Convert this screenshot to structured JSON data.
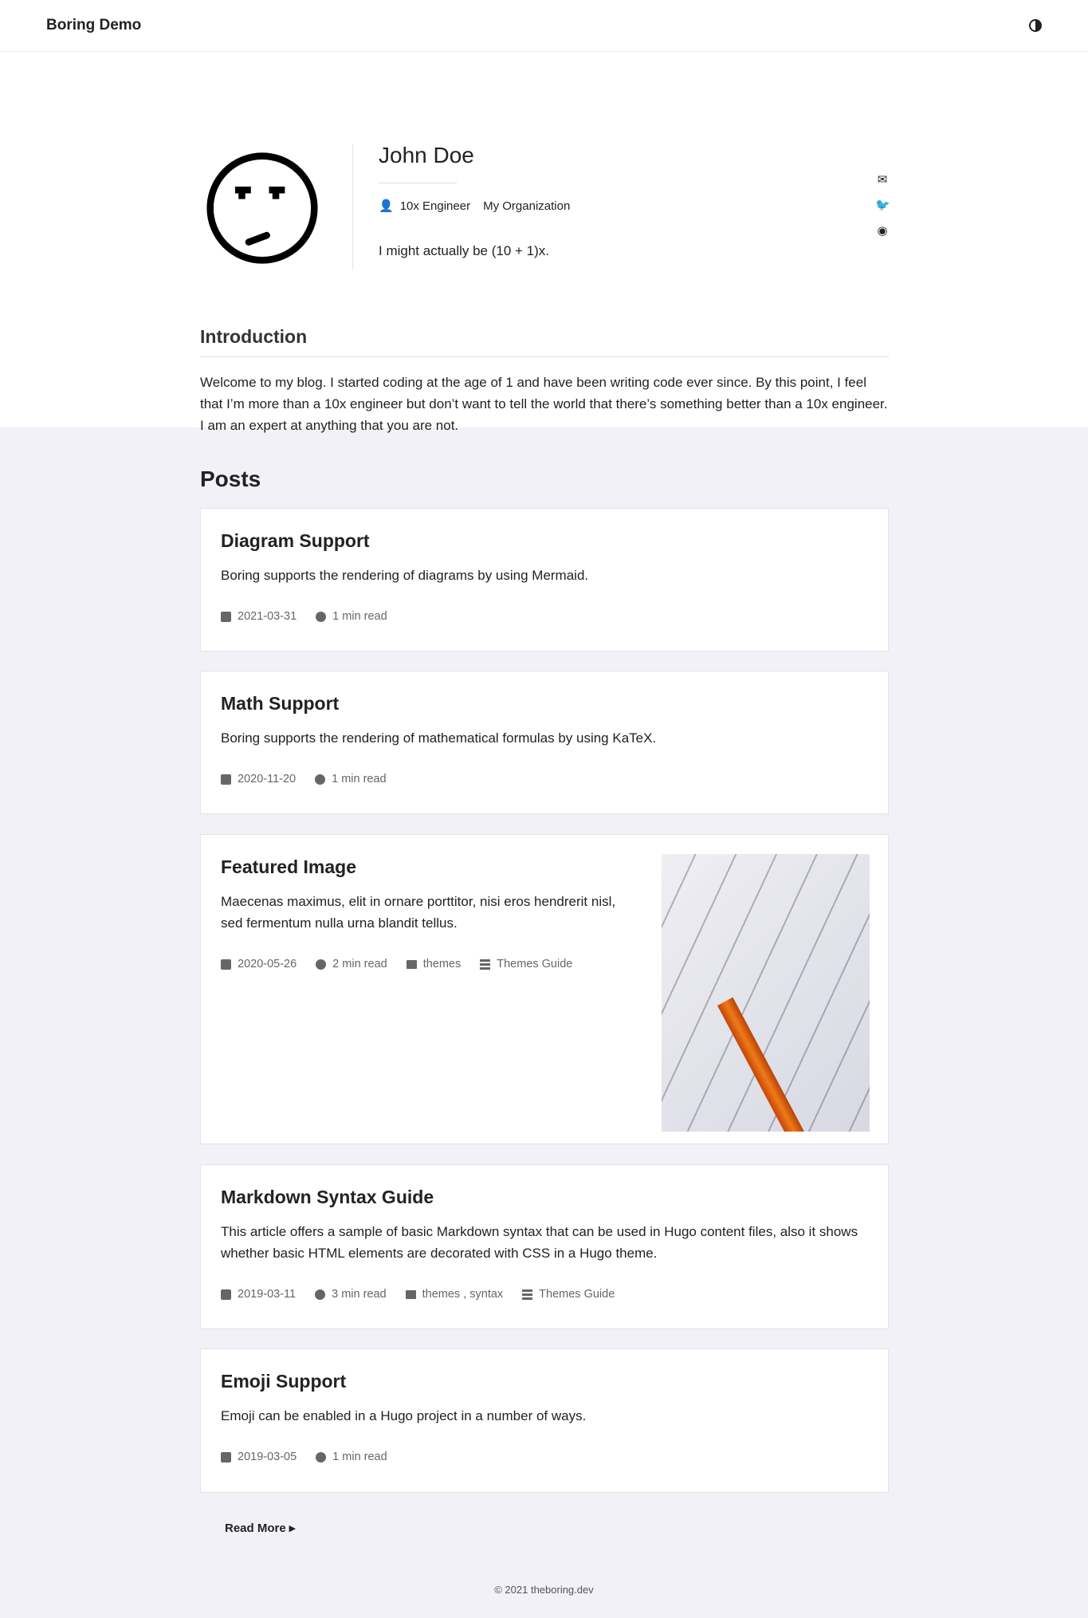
{
  "nav": {
    "brand": "Boring Demo",
    "theme_icon": "half-circle-icon"
  },
  "profile": {
    "name": "John Doe",
    "role": "10x Engineer",
    "organization": "My Organization",
    "bio": "I might actually be (10 + 1)x.",
    "social": [
      "envelope-icon",
      "twitter-icon",
      "github-icon"
    ]
  },
  "intro": {
    "title": "Introduction",
    "text": "Welcome to my blog. I started coding at the age of 1 and have been writing code ever since. By this point, I feel that I’m more than a 10x engineer but don’t want to tell the world that there’s something better than a 10x engineer. I am an expert at anything that you are not."
  },
  "posts": {
    "title": "Posts",
    "items": [
      {
        "title": "Diagram Support",
        "summary": "Boring supports the rendering of diagrams by using Mermaid.",
        "date": "2021-03-31",
        "read": "1 min read"
      },
      {
        "title": "Math Support",
        "summary": "Boring supports the rendering of mathematical formulas by using KaTeX.",
        "date": "2020-11-20",
        "read": "1 min read"
      },
      {
        "title": "Featured Image",
        "summary": "Maecenas maximus, elit in ornare porttitor, nisi eros hendrerit nisl, sed fermentum nulla urna blandit tellus.",
        "date": "2020-05-26",
        "read": "2 min read",
        "categories": "themes",
        "series": "Themes Guide"
      },
      {
        "title": "Markdown Syntax Guide",
        "summary": "This article offers a sample of basic Markdown syntax that can be used in Hugo content files, also it shows whether basic HTML elements are decorated with CSS in a Hugo theme.",
        "date": "2019-03-11",
        "read": "3 min read",
        "categories": "themes , syntax",
        "series": "Themes Guide"
      },
      {
        "title": "Emoji Support",
        "summary": "Emoji can be enabled in a Hugo project in a number of ways.",
        "date": "2019-03-05",
        "read": "1 min read"
      }
    ]
  },
  "read_more": "Read More",
  "footer": "© 2021 theboring.dev"
}
